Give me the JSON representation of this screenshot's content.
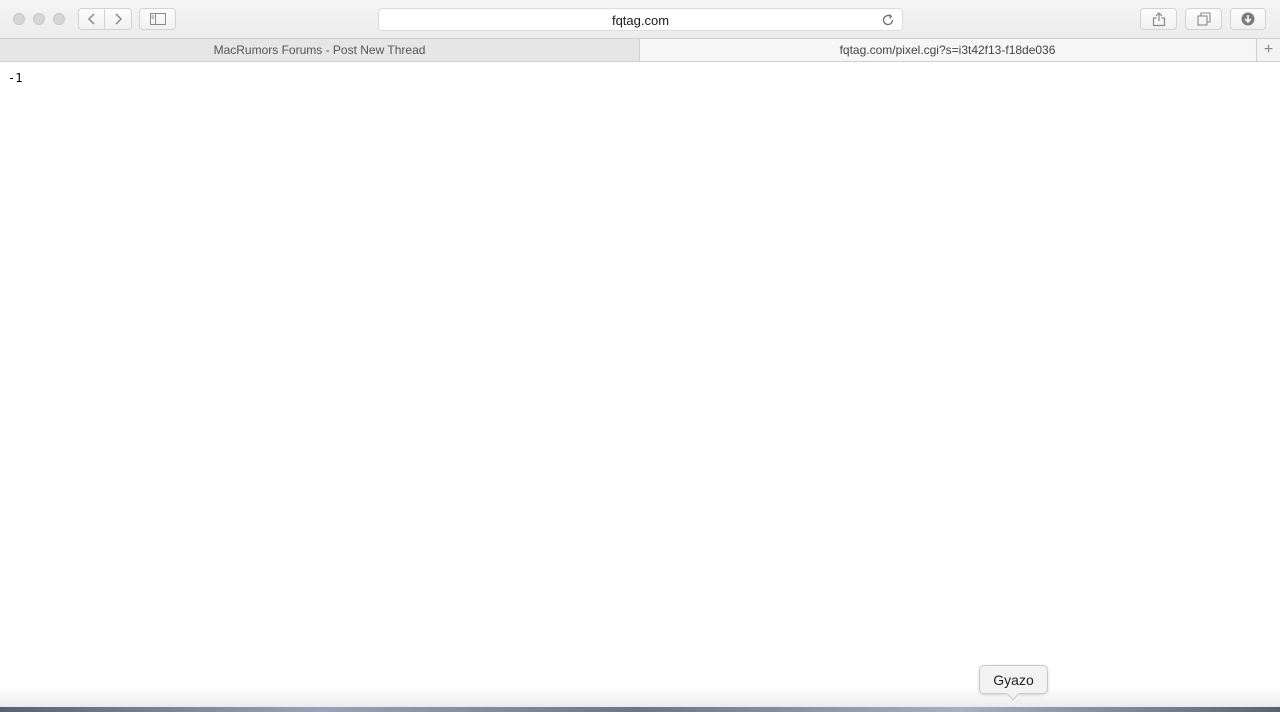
{
  "toolbar": {
    "address": "fqtag.com"
  },
  "tabs": [
    {
      "label": "MacRumors Forums - Post New Thread",
      "active": false
    },
    {
      "label": "fqtag.com/pixel.cgi?s=i3t42f13-f18de036",
      "active": true
    }
  ],
  "new_tab_label": "+",
  "page": {
    "body_text": "-1"
  },
  "dock": {
    "tooltip": "Gyazo"
  }
}
